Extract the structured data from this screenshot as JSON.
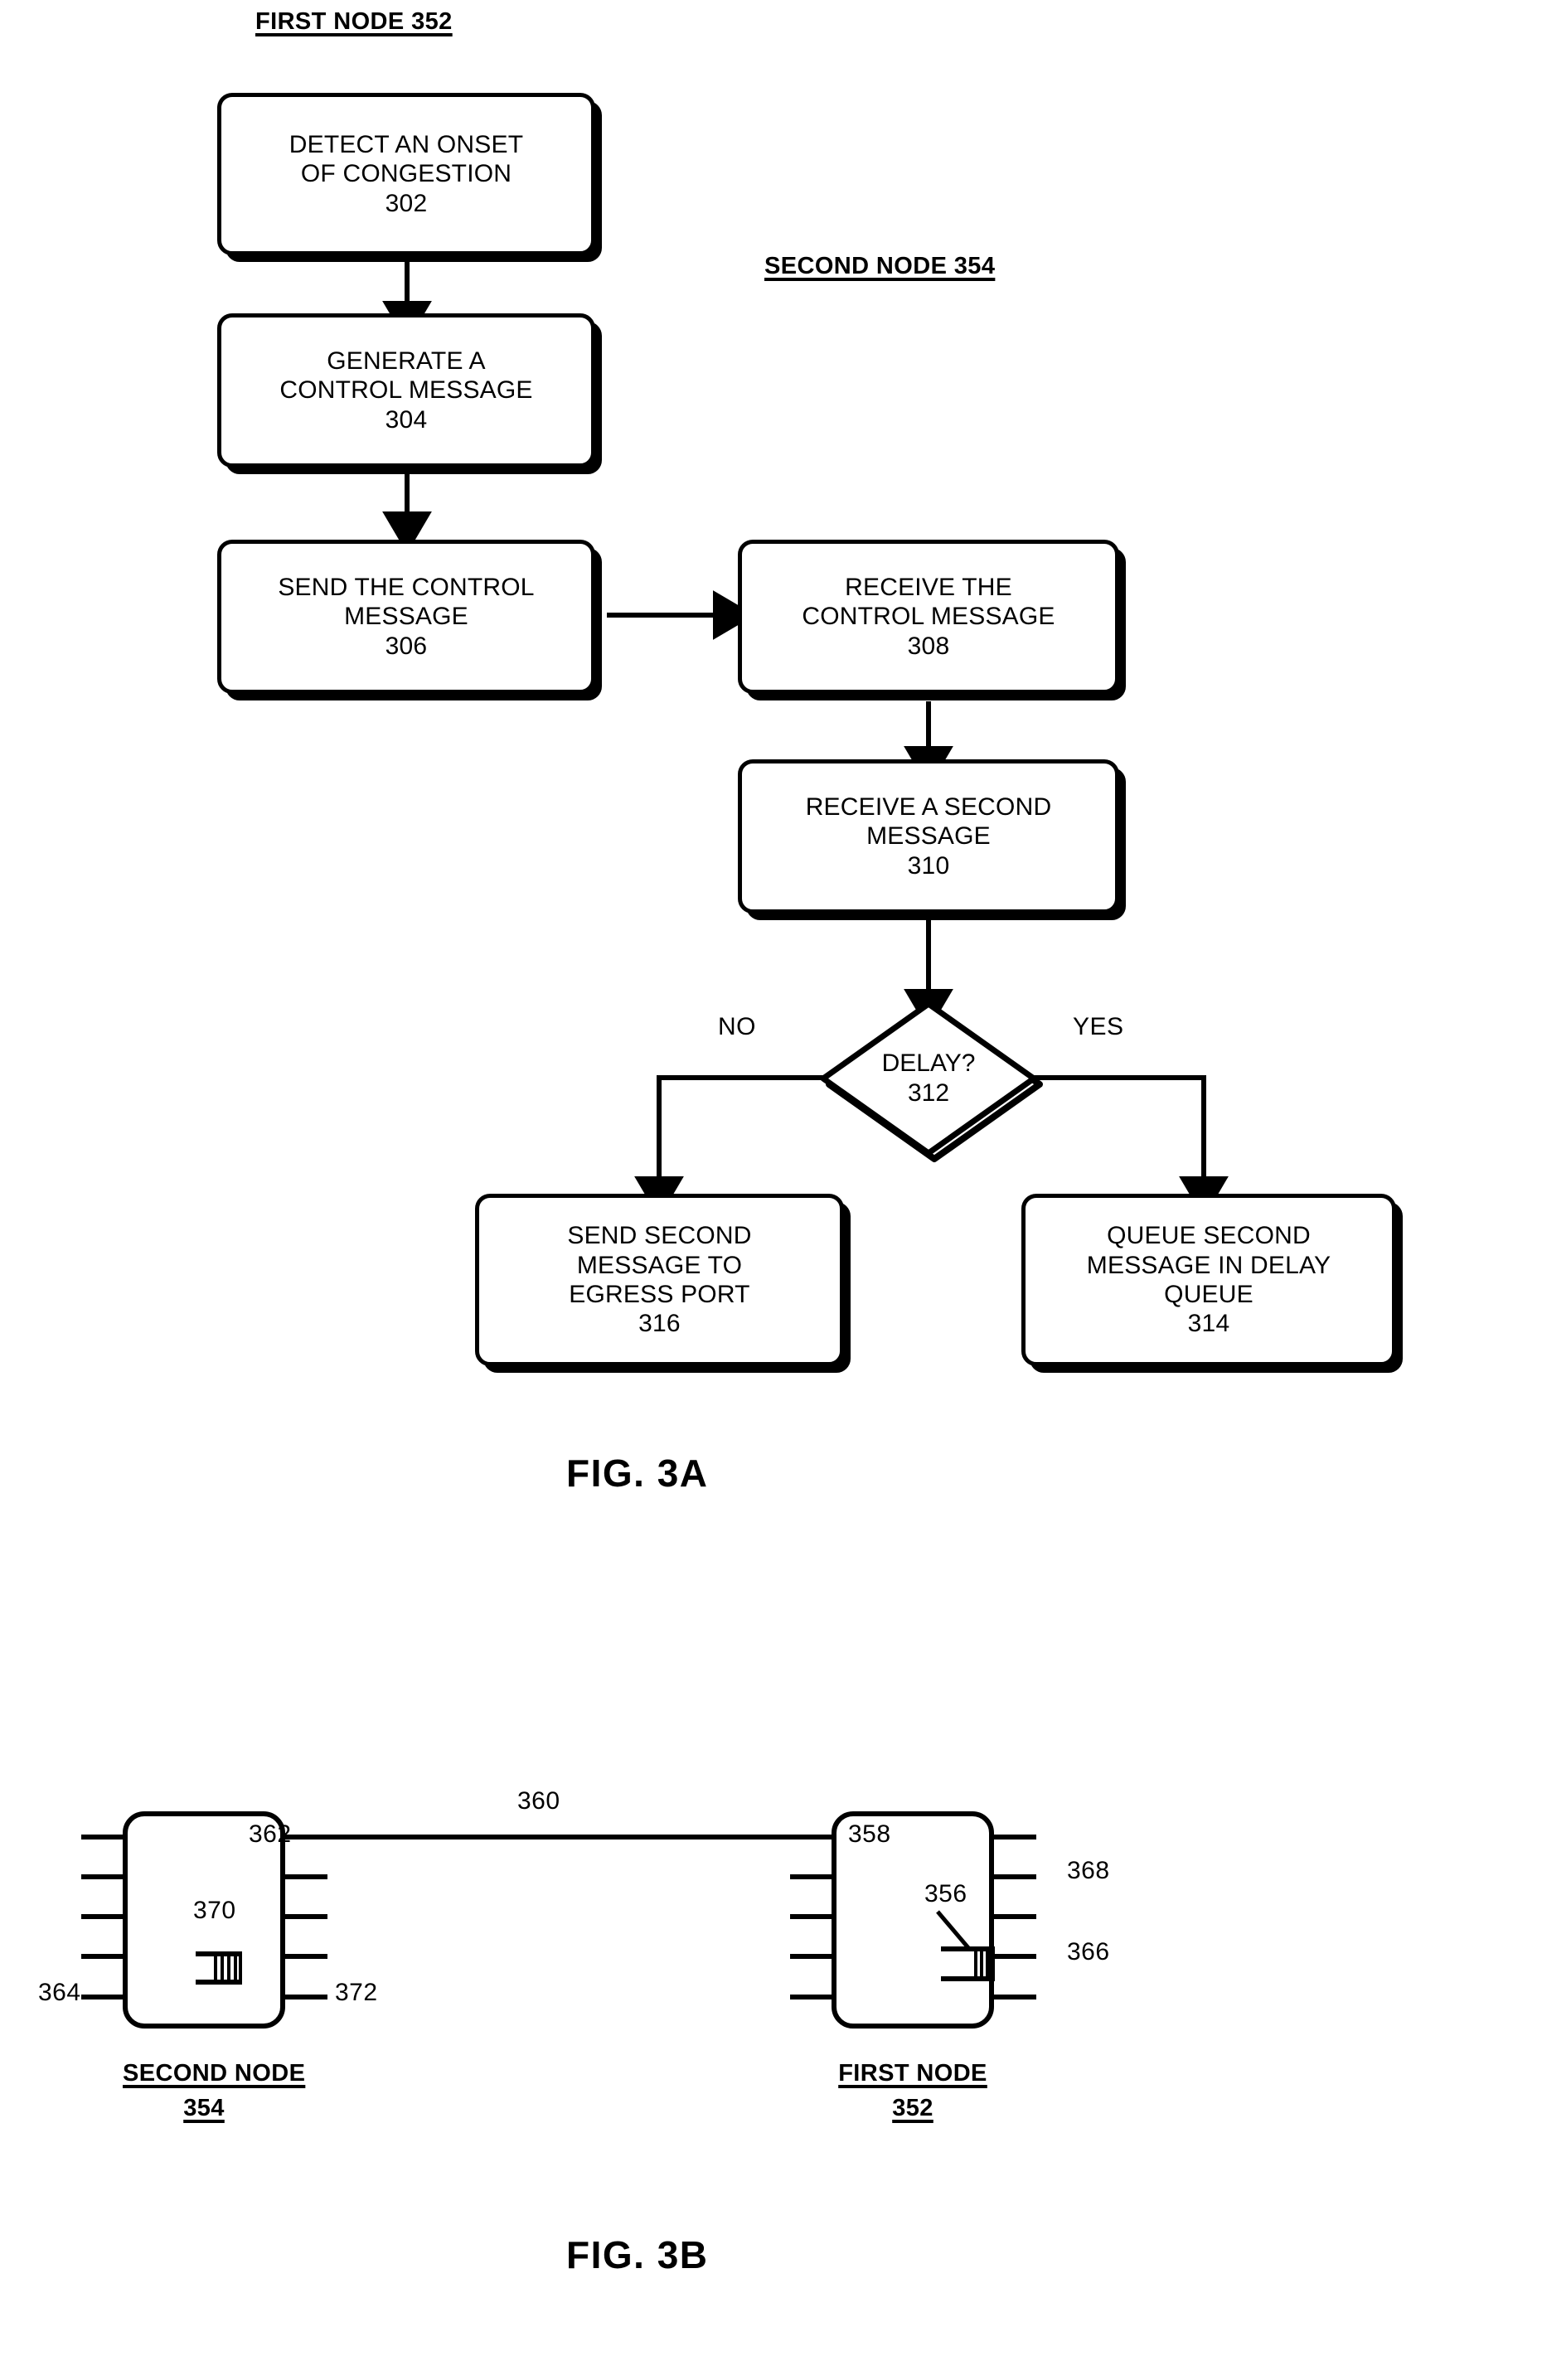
{
  "figures": [
    {
      "caption": "FIG. 3A",
      "type": "flowchart",
      "groups": [
        {
          "label": "FIRST NODE 352"
        },
        {
          "label": "SECOND NODE 354"
        }
      ],
      "nodes": [
        {
          "ref": "302",
          "shape": "process",
          "text": "DETECT AN ONSET\nOF CONGESTION\n302"
        },
        {
          "ref": "304",
          "shape": "process",
          "text": "GENERATE A\nCONTROL MESSAGE\n304"
        },
        {
          "ref": "306",
          "shape": "process",
          "text": "SEND THE CONTROL\nMESSAGE\n306"
        },
        {
          "ref": "308",
          "shape": "process",
          "text": "RECEIVE THE\nCONTROL MESSAGE\n308"
        },
        {
          "ref": "310",
          "shape": "process",
          "text": "RECEIVE A SECOND\nMESSAGE\n310"
        },
        {
          "ref": "312",
          "shape": "decision",
          "text": "DELAY?",
          "number": "312"
        },
        {
          "ref": "316",
          "shape": "process",
          "text": "SEND SECOND\nMESSAGE TO\nEGRESS PORT\n316"
        },
        {
          "ref": "314",
          "shape": "process",
          "text": "QUEUE SECOND\nMESSAGE IN DELAY\nQUEUE\n314"
        }
      ],
      "branch_labels": {
        "no": "NO",
        "yes": "YES"
      }
    },
    {
      "caption": "FIG. 3B",
      "type": "block-diagram",
      "devices": [
        {
          "caption_line1": "SECOND NODE",
          "caption_line2": "354",
          "body_ref": "362",
          "queue_ref": "370",
          "left_bus_ref": "364",
          "right_bus_ref": "372"
        },
        {
          "caption_line1": "FIRST NODE",
          "caption_line2": "352",
          "body_ref": "358",
          "queue_ref": "356",
          "upper_port_ref": "368",
          "queue_port_ref": "366"
        }
      ],
      "link_ref": "360"
    }
  ]
}
